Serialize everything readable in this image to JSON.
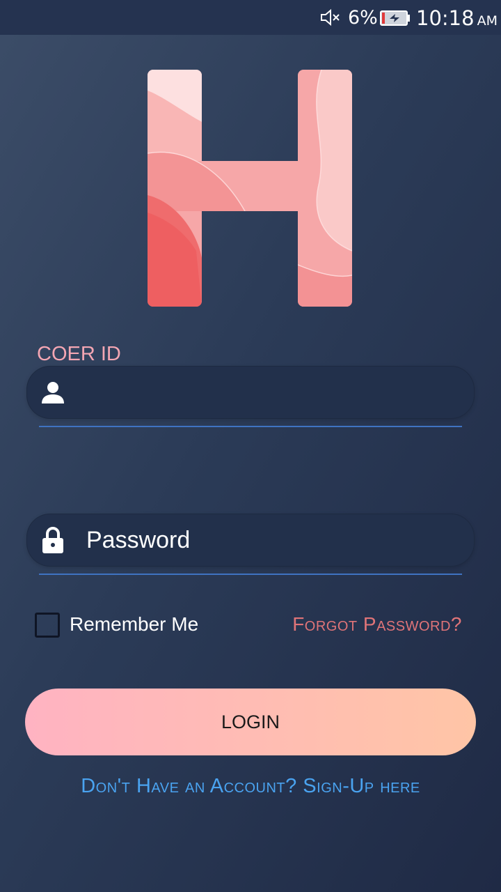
{
  "status_bar": {
    "battery_percent": "6%",
    "time": "10:18",
    "ampm": "AM",
    "icons": [
      "mute-icon",
      "battery-charging-icon"
    ]
  },
  "logo": {
    "icon": "h-logo-icon"
  },
  "login_form": {
    "id_label": "COER ID",
    "id_value": "",
    "id_icon": "person-icon",
    "password_placeholder": "Password",
    "password_icon": "lock-icon",
    "remember_label": "Remember Me",
    "remember_checked": false,
    "forgot_label": "Forgot Password?",
    "login_label": "LOGIN",
    "signup_label": "Don't Have an Account? Sign-Up here"
  },
  "colors": {
    "accent_pink": "#f4a6b3",
    "forgot": "#e07478",
    "signup": "#4aa3f0",
    "underline": "#3f73c2",
    "button_start": "#ffb3c2",
    "button_end": "#ffc5a6"
  }
}
